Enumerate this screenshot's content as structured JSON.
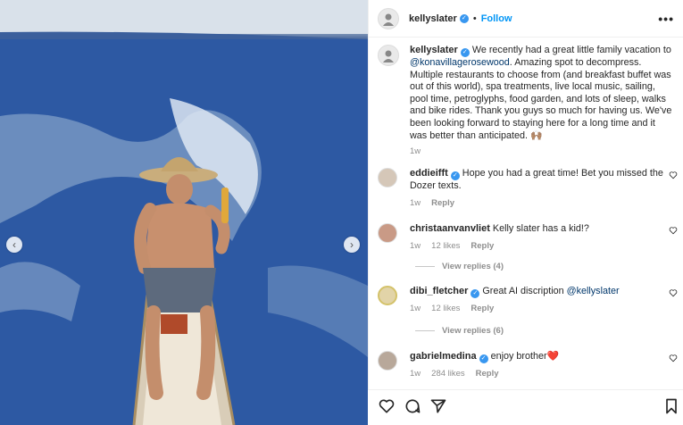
{
  "post": {
    "author": "kellyslater",
    "follow_label": "Follow",
    "more_label": "•••",
    "caption_text": "We recently had a great little family vacation to",
    "caption_mention": "@konavillagerosewood",
    "caption_rest": ". Amazing spot to decompress. Multiple restaurants to choose from (and breakfast buffet was out of this world), spa treatments, live local music, sailing, pool time, petroglyphs, food garden, and lots of sleep, walks and bike rides. Thank you guys so much for having us. We've been looking forward to staying here for a long time and it was better than anticipated. 🙌🏽",
    "time": "1w"
  },
  "media": {
    "prev_icon": "‹",
    "next_icon": "›"
  },
  "comments": [
    {
      "user": "eddieifft",
      "verified": true,
      "text": "Hope you had a great time! Bet you missed the Dozer texts.",
      "time": "1w",
      "likes": "",
      "reply": "Reply"
    },
    {
      "user": "christaanvanvliet",
      "verified": false,
      "text": "Kelly slater has a kid!?",
      "time": "1w",
      "likes": "12 likes",
      "reply": "Reply",
      "view_replies": "View replies (4)"
    },
    {
      "user": "dibi_fletcher",
      "verified": true,
      "text": "Great AI discription",
      "mention": "@kellyslater",
      "time": "1w",
      "likes": "12 likes",
      "reply": "Reply",
      "view_replies": "View replies (6)"
    },
    {
      "user": "gabrielmedina",
      "verified": true,
      "text": "enjoy brother❤️",
      "time": "1w",
      "likes": "284 likes",
      "reply": "Reply"
    }
  ],
  "icons": [
    "heart-icon",
    "comment-icon",
    "share-icon",
    "bookmark-icon",
    "verified-icon",
    "more-icon"
  ],
  "colors": {
    "accent": "#0095f6",
    "verified": "#3897f0",
    "muted": "#8e8e8e",
    "mention": "#00376b"
  }
}
